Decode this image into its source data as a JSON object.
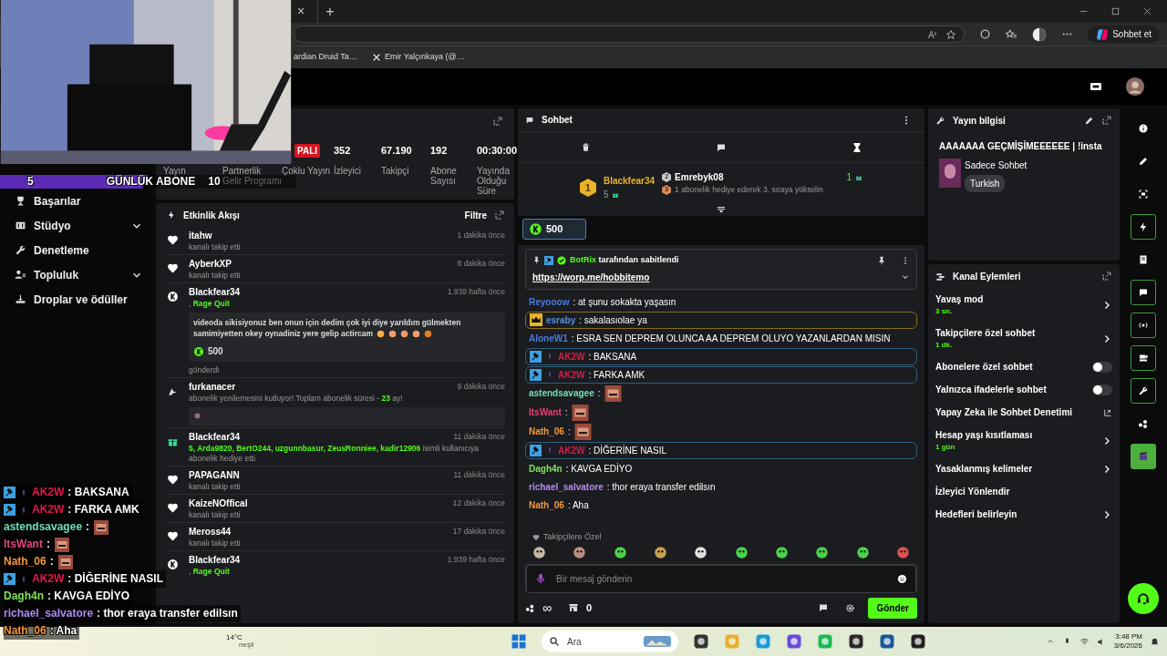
{
  "browser": {
    "tab_close": "×",
    "new_tab": "+",
    "bookmarks": [
      {
        "label": "ardian Druid Ta…"
      },
      {
        "label": "Emir Yalçınkaya (@…"
      }
    ],
    "copilot": "Sohbet et"
  },
  "sub_goal": {
    "current": "5",
    "label": "GÜNLÜK ABONE",
    "target": "10",
    "level": 0.5
  },
  "sidebar": {
    "items": [
      {
        "label": "Başarılar",
        "expandable": false
      },
      {
        "label": "Stüdyo",
        "expandable": true
      },
      {
        "label": "Denetleme",
        "expandable": false
      },
      {
        "label": "Topluluk",
        "expandable": true
      },
      {
        "label": "Droplar ve ödüller",
        "expandable": false
      }
    ]
  },
  "stats": {
    "columns": [
      {
        "label": "Yayın"
      },
      {
        "label": "Partnerlik Gelir Programı"
      },
      {
        "label": "Çoklu Yayın",
        "badge": "PALI"
      },
      {
        "value": "352",
        "label": "İzleyici"
      },
      {
        "value": "67.190",
        "label": "Takipçi"
      },
      {
        "value": "192",
        "label": "Abone Sayısı"
      },
      {
        "value": "00:30:00",
        "label": "Yayında Olduğu Süre"
      }
    ]
  },
  "feed": {
    "title": "Etkinlik Akışı",
    "filter": "Filtre",
    "items": [
      {
        "kind": "follow",
        "name": "itahw",
        "time": "1 dakika önce",
        "detail": {
          "before": "kanalı takip etti"
        }
      },
      {
        "kind": "follow",
        "name": "AyberkXP",
        "time": "8 dakika önce",
        "detail": {
          "before": "kanalı takip etti"
        }
      },
      {
        "kind": "kicks",
        "name": "Blackfear34",
        "time": "1.939 hafta önce",
        "detail": {
          "before": ", ",
          "highlight": "Rage Quit"
        },
        "message": "videoda sikisiyonuz ben onun için dedim çok iyi diye yarıldım gülmekten samimiyetten okey oynadiniz yere gelip actircam",
        "amount": "500",
        "footer": "gönderdi"
      },
      {
        "kind": "renewal",
        "name": "furkanacer",
        "time": "9 dakika önce",
        "detail": {
          "before": "abonelik yenilemesini kutluyor! Toplam abonelik süresi - ",
          "highlight": "23",
          "after": " ay!"
        }
      },
      {
        "kind": "gift",
        "name": "Blackfear34",
        "time": "11 dakika önce",
        "detail": {
          "highlight": "5, Arda9820, BertO244, uzgunnbasur, ZeusRonniee, kadir12906",
          "after": " isimli kullanıcıya abonelik hediye etti."
        }
      },
      {
        "kind": "follow",
        "name": "PAPAGANN",
        "time": "11 dakika önce",
        "detail": {
          "before": "kanalı takip etti"
        }
      },
      {
        "kind": "follow",
        "name": "KaizeNOffical",
        "time": "12 dakika önce",
        "detail": {
          "before": "kanalı takip etti"
        }
      },
      {
        "kind": "follow",
        "name": "Meross44",
        "time": "17 dakika önce",
        "detail": {
          "before": "kanalı takip etti"
        }
      },
      {
        "kind": "kicks",
        "name": "Blackfear34",
        "time": "1.939 hafta önce",
        "detail": {
          "before": ", ",
          "highlight": "Rage Quit"
        }
      }
    ]
  },
  "chat": {
    "title": "Sohbet",
    "leaders": [
      {
        "rank": "1",
        "name": "Blackfear34",
        "count": "5"
      },
      {
        "rank": "2",
        "name": "Emrebyk08",
        "count": "1"
      }
    ],
    "next_rank": {
      "rank": "3",
      "text": "1 abonelik hediye ederek 3. sıraya yükselin"
    },
    "kicks": "500",
    "pinned": {
      "by": "BotRix",
      "note": " tarafından sabitlendi",
      "link": "https://worp.me/hobbitemo"
    },
    "messages": [
      {
        "kind": "plain",
        "name": "Reyooow",
        "color": "#4a7be0",
        "text": ": at şunu sokakta yaşasın"
      },
      {
        "kind": "highlight",
        "name": "esraby",
        "color": "#4f8fe8",
        "text": ": sakalasıolae ya"
      },
      {
        "kind": "plain",
        "name": "AloneW1",
        "color": "#4a7be0",
        "text": ": ESRA SEN DEPREM OLUNCA AA DEPREM OLUYO YAZANLARDAN MISIN"
      },
      {
        "kind": "mod",
        "name": "AK2W",
        "color": "#e3174b",
        "text": ": BAKSANA"
      },
      {
        "kind": "mod",
        "name": "AK2W",
        "color": "#e3174b",
        "text": ": FARKA AMK"
      },
      {
        "kind": "emote",
        "name": "astendsavagee",
        "color": "#6fe0b8",
        "text": ":"
      },
      {
        "kind": "emote",
        "name": "ItsWant",
        "color": "#e0447a",
        "text": ":"
      },
      {
        "kind": "emote",
        "name": "Nath_06",
        "color": "#f5983c",
        "text": ":"
      },
      {
        "kind": "mod",
        "name": "AK2W",
        "color": "#e3174b",
        "text": ": DİĞERİNE NASIL"
      },
      {
        "kind": "plain",
        "name": "Dagh4n",
        "color": "#7fe35a",
        "text": ": KAVGA EDİYO"
      },
      {
        "kind": "plain",
        "name": "richael_salvatore",
        "color": "#b48af5",
        "text": ": thor eraya transfer edilsın"
      },
      {
        "kind": "plain",
        "name": "Nath_06",
        "color": "#f5983c",
        "text": ": Aha"
      }
    ],
    "emote_label": "Takipçilere Özel",
    "placeholder": "Bir mesaj gönderin",
    "infinity": "∞",
    "gift_count": "0",
    "send": "Gönder"
  },
  "stream_info": {
    "title": "Yayın bilgisi",
    "stream_title": "AAAAAAA GEÇMİŞİMEEEEEE | !insta",
    "category": "Sadece Sohbet",
    "tag": "Turkish"
  },
  "channel_actions": {
    "title": "Kanal Eylemleri",
    "items": [
      {
        "kind": "submenu",
        "label": "Yavaş mod",
        "value": "3 sn."
      },
      {
        "kind": "submenu",
        "label": "Takipçilere özel sohbet",
        "value": "1 dk."
      },
      {
        "kind": "toggle",
        "label": "Abonelere özel sohbet",
        "on": false
      },
      {
        "kind": "toggle",
        "label": "Yalnızca ifadelerle sohbet",
        "on": false
      },
      {
        "kind": "external",
        "label": "Yapay Zeka ile Sohbet Denetimi"
      },
      {
        "kind": "submenu",
        "label": "Hesap yaşı kısıtlaması",
        "value": "1 gün"
      },
      {
        "kind": "submenu",
        "label": "Yasaklanmış kelimeler"
      },
      {
        "kind": "plain",
        "label": "İzleyici Yönlendir"
      },
      {
        "kind": "submenu",
        "label": "Hedefleri belirleyin"
      }
    ]
  },
  "rail": [
    {
      "kind": "plain"
    },
    {
      "kind": "plain"
    },
    {
      "kind": "plain"
    },
    {
      "kind": "outlined"
    },
    {
      "kind": "plain"
    },
    {
      "kind": "outlined"
    },
    {
      "kind": "outlined"
    },
    {
      "kind": "outlined"
    },
    {
      "kind": "outlined"
    },
    {
      "kind": "plain"
    },
    {
      "kind": "filled"
    }
  ],
  "overlay_chat": [
    {
      "kind": "mod",
      "name": "AK2W",
      "color": "#e3174b",
      "text": " : BAKSANA"
    },
    {
      "kind": "mod",
      "name": "AK2W",
      "color": "#e3174b",
      "text": " : FARKA AMK"
    },
    {
      "kind": "emote",
      "name": "astendsavagee",
      "color": "#6fe0b8",
      "text": " :"
    },
    {
      "kind": "emote",
      "name": "ItsWant",
      "color": "#e0447a",
      "text": " :"
    },
    {
      "kind": "emote",
      "name": "Nath_06",
      "color": "#f5983c",
      "text": " :"
    },
    {
      "kind": "mod",
      "name": "AK2W",
      "color": "#e3174b",
      "text": " : DİĞERİNE NASIL"
    },
    {
      "kind": "plain",
      "name": "Dagh4n",
      "color": "#7fe35a",
      "text": " : KAVGA EDİYO"
    },
    {
      "kind": "plain",
      "name": "richael_salvatore",
      "color": "#b48af5",
      "text": " : thor eraya transfer edilsın"
    },
    {
      "kind": "plain",
      "name": "Nath_06",
      "color": "#f5983c",
      "text": " : Aha"
    }
  ],
  "taskbar": {
    "temperature": "14°C",
    "weather": "neşli",
    "search": "Ara",
    "time": "3:48 PM",
    "date": "3/6/2026"
  }
}
